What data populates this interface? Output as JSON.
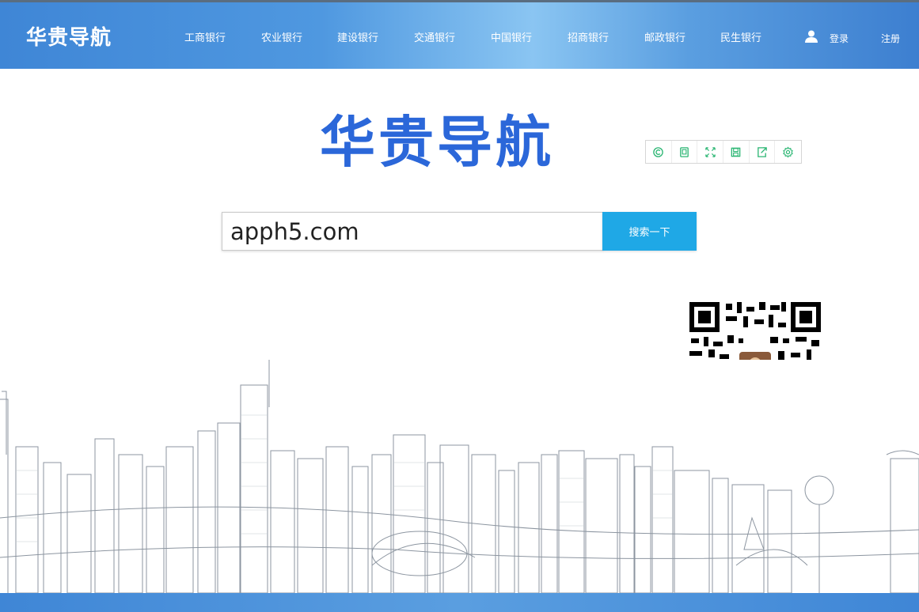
{
  "header": {
    "brand": "华贵导航",
    "nav": [
      "工商银行",
      "农业银行",
      "建设银行",
      "交通银行",
      "中国银行",
      "招商银行",
      "邮政银行",
      "民生银行"
    ],
    "login": "登录",
    "register": "注册"
  },
  "main": {
    "logo_text": "华贵导航",
    "tools": [
      "refresh-icon",
      "copy-icon",
      "fullscreen-icon",
      "save-icon",
      "share-icon",
      "settings-icon"
    ],
    "search": {
      "value": "apph5.com",
      "button": "搜索一下"
    }
  },
  "colors": {
    "header_blue": "#3f86d6",
    "logo_blue": "#2b67d9",
    "search_button": "#1fa8e6",
    "tool_green": "#2bb673"
  }
}
